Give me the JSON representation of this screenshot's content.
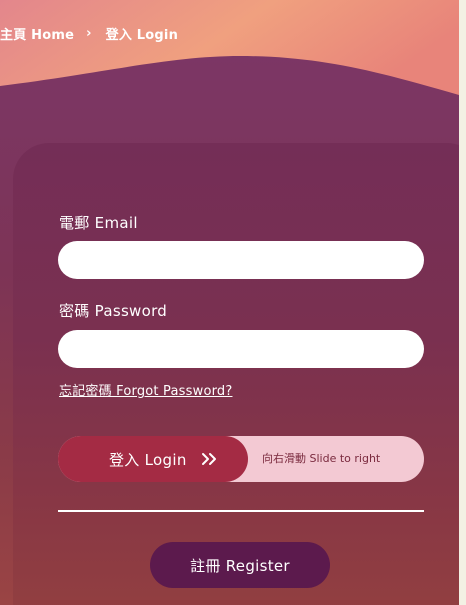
{
  "breadcrumb": {
    "home_label": "主頁 Home",
    "separator": "›",
    "current_label": "登入 Login"
  },
  "form": {
    "email_label": "電郵 Email",
    "email_value": "",
    "password_label": "密碼 Password",
    "password_value": "",
    "forgot_label": "忘記密碼 Forgot Password?"
  },
  "slider": {
    "handle_label": "登入 Login",
    "hint": "向右滑動 Slide to right"
  },
  "register": {
    "label": "註冊 Register"
  },
  "colors": {
    "header_gradient_start": "#f1a27f",
    "header_gradient_end": "#e07f76",
    "card": "#7a3050",
    "slider_handle": "#a42b44",
    "slider_track": "#f3c9d3",
    "register_button": "#5c1a4d"
  }
}
